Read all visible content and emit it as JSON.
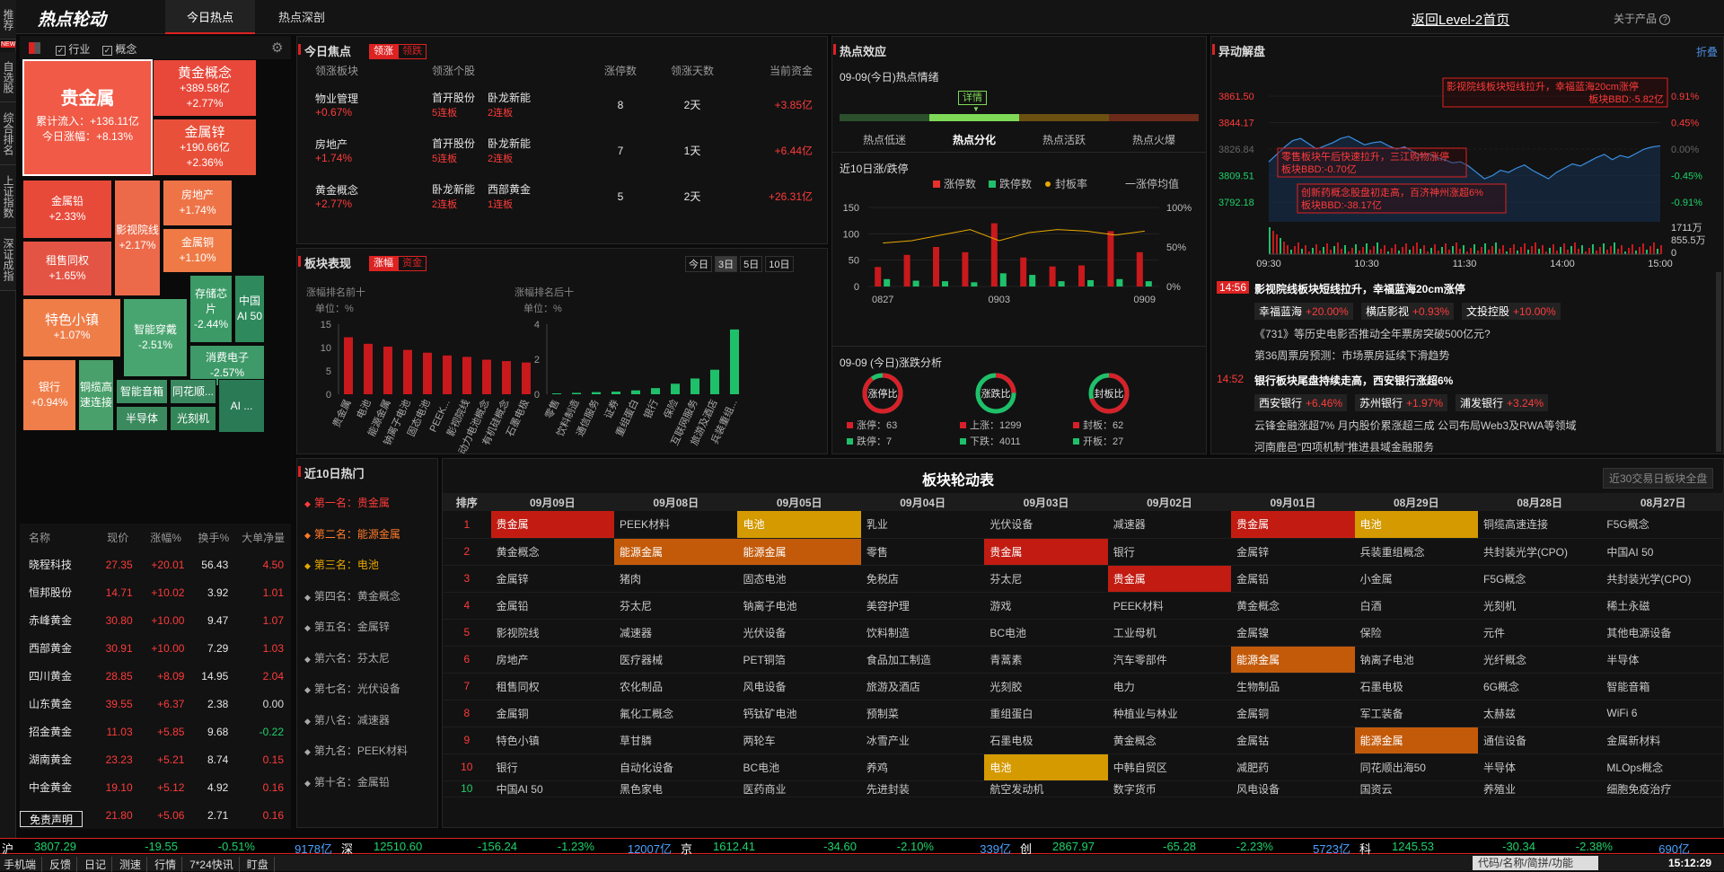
{
  "app": {
    "logo": "热点轮动",
    "tabs": [
      "今日热点",
      "热点深剖"
    ],
    "back_link": "返回Level-2首页",
    "about": "关于产品"
  },
  "sidetabs": [
    "推荐",
    "自选股",
    "综合排名",
    "上证指数",
    "深证成指"
  ],
  "sidetab_new": "NEW",
  "filter": {
    "industry": "行业",
    "concept": "概念"
  },
  "treemap": [
    {
      "name": "贵金属",
      "l1": "累计流入：+136.11亿",
      "l2": "今日涨幅：+8.13%"
    },
    {
      "name": "黄金概念",
      "l1": "+389.58亿",
      "l2": "+2.77%"
    },
    {
      "name": "金属锌",
      "l1": "+190.66亿",
      "l2": "+2.36%"
    },
    {
      "name": "金属铅",
      "l1": "+2.33%"
    },
    {
      "name": "影视院线",
      "l1": "+2.17%"
    },
    {
      "name": "房地产",
      "l1": "+1.74%"
    },
    {
      "name": "租售同权",
      "l1": "+1.65%"
    },
    {
      "name": "金属铜",
      "l1": "+1.10%"
    },
    {
      "name": "特色小镇",
      "l1": "+1.07%"
    },
    {
      "name": "智能穿戴",
      "l1": "-2.51%"
    },
    {
      "name": "存储芯片",
      "l1": "-2.44%"
    },
    {
      "name": "中国AI 50",
      "l1": ""
    },
    {
      "name": "消费电子",
      "l1": "-2.57%"
    },
    {
      "name": "银行",
      "l1": "+0.94%"
    },
    {
      "name": "铜缆高速连接",
      "l1": ""
    },
    {
      "name": "智能音箱",
      "l1": ""
    },
    {
      "name": "同花顺...",
      "l1": ""
    },
    {
      "name": "AI ...",
      "l1": ""
    },
    {
      "name": "半导体",
      "l1": ""
    },
    {
      "name": "光刻机",
      "l1": ""
    }
  ],
  "stocks": {
    "headers": [
      "名称",
      "现价",
      "涨幅%",
      "换手%",
      "大单净量"
    ],
    "rows": [
      [
        "晓程科技",
        "27.35",
        "+20.01",
        "56.43",
        "4.50"
      ],
      [
        "恒邦股份",
        "14.71",
        "+10.02",
        "3.92",
        "1.01"
      ],
      [
        "赤峰黄金",
        "30.80",
        "+10.00",
        "9.47",
        "1.07"
      ],
      [
        "西部黄金",
        "30.91",
        "+10.00",
        "7.29",
        "1.03"
      ],
      [
        "四川黄金",
        "28.85",
        "+8.09",
        "14.95",
        "2.04"
      ],
      [
        "山东黄金",
        "39.55",
        "+6.37",
        "2.38",
        "0.00"
      ],
      [
        "招金黄金",
        "11.03",
        "+5.85",
        "9.68",
        "-0.22"
      ],
      [
        "湖南黄金",
        "23.23",
        "+5.21",
        "8.74",
        "0.15"
      ],
      [
        "中金黄金",
        "19.10",
        "+5.12",
        "4.92",
        "0.16"
      ],
      [
        "",
        "21.80",
        "+5.06",
        "2.71",
        "0.16"
      ]
    ]
  },
  "disclaimer": "免责声明",
  "focus": {
    "title": "今日焦点",
    "tag_on": "领涨",
    "tag_off": "领跌",
    "headers": [
      "领涨板块",
      "领涨个股",
      "涨停数",
      "领涨天数",
      "当前资金"
    ],
    "rows": [
      {
        "sector": "物业管理",
        "pct": "+0.67%",
        "s1": "首开股份",
        "s1b": "5连板",
        "s2": "卧龙新能",
        "s2b": "2连板",
        "limit": "8",
        "days": "2天",
        "fund": "+3.85亿"
      },
      {
        "sector": "房地产",
        "pct": "+1.74%",
        "s1": "首开股份",
        "s1b": "5连板",
        "s2": "卧龙新能",
        "s2b": "2连板",
        "limit": "7",
        "days": "1天",
        "fund": "+6.44亿"
      },
      {
        "sector": "黄金概念",
        "pct": "+2.77%",
        "s1": "卧龙新能",
        "s1b": "2连板",
        "s2": "西部黄金",
        "s2b": "1连板",
        "limit": "5",
        "days": "2天",
        "fund": "+26.31亿"
      }
    ]
  },
  "perf": {
    "title": "板块表现",
    "tag_on": "涨幅",
    "tag_off": "资金",
    "periods": [
      "今日",
      "3日",
      "5日",
      "10日"
    ],
    "left_title": "涨幅排名前十",
    "right_title": "涨幅排名后十",
    "unit": "单位：%",
    "left_cats": [
      "贵金属",
      "电池",
      "能源金属",
      "钠离子电池",
      "固态电池",
      "PEEK...",
      "影视院线",
      "动力电池概念",
      "有机硅概念",
      "石墨电极"
    ],
    "left_vals": [
      12.2,
      10.8,
      10.2,
      9.5,
      8.9,
      8.3,
      8.0,
      7.4,
      7.1,
      6.8
    ],
    "left_ymax": 15,
    "left_ticks": [
      "15",
      "10",
      "5",
      "0"
    ],
    "right_cats": [
      "零售",
      "饮料制造",
      "通信服务",
      "证券",
      "重组蛋白",
      "银行",
      "保险",
      "互联网服务",
      "旅游及酒店",
      "兵装重组..."
    ],
    "right_vals": [
      0.05,
      0.08,
      0.12,
      0.15,
      0.22,
      0.35,
      0.6,
      0.9,
      1.4,
      3.7
    ],
    "right_ymax": 4,
    "right_ticks": [
      "4",
      "2",
      "0"
    ]
  },
  "effect": {
    "title": "热点效应",
    "date": "09-09(今日)热点情绪",
    "detail": "详情",
    "levels": [
      "热点低迷",
      "热点分化",
      "热点活跃",
      "热点火爆"
    ],
    "chart_title": "近10日涨/跌停",
    "legend": [
      "涨停数",
      "跌停数",
      "封板率",
      "一涨停均值"
    ],
    "x_labels": [
      "0827",
      "0903",
      "0909"
    ],
    "ticks_left": [
      "150",
      "100",
      "50",
      "0"
    ],
    "ticks_right": [
      "100%",
      "50%",
      "0%"
    ],
    "limit_up": [
      37,
      60,
      75,
      65,
      120,
      55,
      38,
      40,
      105,
      65
    ],
    "limit_down": [
      14,
      11,
      10,
      8,
      25,
      22,
      10,
      12,
      14,
      10
    ],
    "seal_rate": [
      55,
      58,
      65,
      72,
      58,
      68,
      72,
      70,
      65,
      70
    ],
    "analysis_title": "09-09 (今日)涨跌分析",
    "rings": [
      {
        "label": "涨停比",
        "a": "涨停：63",
        "b": "跌停：7"
      },
      {
        "label": "涨跌比",
        "a": "上涨：1299",
        "b": "下跌：4011"
      },
      {
        "label": "封板比",
        "a": "封板：62",
        "b": "开板：27"
      }
    ]
  },
  "abnormal": {
    "title": "异动解盘",
    "fold": "折叠",
    "y_left": [
      "3861.50",
      "3844.17",
      "3826.84",
      "3809.51",
      "3792.18"
    ],
    "y_right": [
      "0.91%",
      "0.45%",
      "0.00%",
      "-0.45%",
      "-0.91%"
    ],
    "vol": [
      "1711万",
      "855.5万",
      "0"
    ],
    "x_labels": [
      "09:30",
      "10:30",
      "11:30",
      "14:00",
      "15:00"
    ],
    "notes": [
      {
        "l1": "影视院线板块短线拉升，幸福蓝海20cm涨停",
        "l2": "板块BBD:-5.82亿"
      },
      {
        "l1": "零售板块午后快速拉升，三江购物涨停",
        "l2": "板块BBD:-0.70亿"
      },
      {
        "l1": "创新药概念股盘初走高，百济神州涨超6%",
        "l2": "板块BBD:-38.17亿"
      }
    ],
    "news": [
      {
        "time": "14:56",
        "title": "影视院线板块短线拉升，幸福蓝海20cm涨停",
        "stocks": [
          [
            "幸福蓝海",
            "+20.00%"
          ],
          [
            "横店影视",
            "+0.93%"
          ],
          [
            "文投控股",
            "+10.00%"
          ]
        ],
        "lines": [
          "《731》等历史电影否推动全年票房突破500亿元?",
          "第36周票房预测：市场票房延续下滑趋势"
        ]
      },
      {
        "time": "14:52",
        "title": "银行板块尾盘持续走高，西安银行涨超6%",
        "stocks": [
          [
            "西安银行",
            "+6.46%"
          ],
          [
            "苏州银行",
            "+1.97%"
          ],
          [
            "浦发银行",
            "+3.24%"
          ]
        ],
        "lines": [
          "云锋金融涨超7% 月内股价累涨超三成 公司布局Web3及RWA等领域",
          "河南鹿邑“四项机制”推进县域金融服务"
        ]
      }
    ]
  },
  "hot10": {
    "title": "近10日热门",
    "items": [
      "第一名：贵金属",
      "第二名：能源金属",
      "第三名：电池",
      "第四名：黄金概念",
      "第五名：金属锌",
      "第六名：芬太尼",
      "第七名：光伏设备",
      "第八名：减速器",
      "第九名：PEEK材料",
      "第十名：金属铅"
    ]
  },
  "rotation": {
    "title": "板块轮动表",
    "btn": "近30交易日板块全盘",
    "headers": [
      "排序",
      "09月09日",
      "09月08日",
      "09月05日",
      "09月04日",
      "09月03日",
      "09月02日",
      "09月01日",
      "08月29日",
      "08月28日",
      "08月27日"
    ],
    "rows": [
      [
        "1",
        "贵金属",
        "PEEK材料",
        "电池",
        "乳业",
        "光伏设备",
        "减速器",
        "贵金属",
        "电池",
        "铜缆高速连接",
        "F5G概念"
      ],
      [
        "2",
        "黄金概念",
        "能源金属",
        "能源金属",
        "零售",
        "贵金属",
        "银行",
        "金属锌",
        "兵装重组概念",
        "共封装光学(CPO)",
        "中国AI 50"
      ],
      [
        "3",
        "金属锌",
        "猪肉",
        "固态电池",
        "免税店",
        "芬太尼",
        "贵金属",
        "金属铅",
        "小金属",
        "F5G概念",
        "共封装光学(CPO)"
      ],
      [
        "4",
        "金属铅",
        "芬太尼",
        "钠离子电池",
        "美容护理",
        "游戏",
        "PEEK材料",
        "黄金概念",
        "白酒",
        "光刻机",
        "稀土永磁"
      ],
      [
        "5",
        "影视院线",
        "减速器",
        "光伏设备",
        "饮料制造",
        "BC电池",
        "工业母机",
        "金属镍",
        "保险",
        "元件",
        "其他电源设备"
      ],
      [
        "6",
        "房地产",
        "医疗器械",
        "PET铜箔",
        "食品加工制造",
        "青蒿素",
        "汽车零部件",
        "能源金属",
        "钠离子电池",
        "光纤概念",
        "半导体"
      ],
      [
        "7",
        "租售同权",
        "农化制品",
        "风电设备",
        "旅游及酒店",
        "光刻胶",
        "电力",
        "生物制品",
        "石墨电极",
        "6G概念",
        "智能音箱"
      ],
      [
        "8",
        "金属铜",
        "氟化工概念",
        "钙钛矿电池",
        "预制菜",
        "重组蛋白",
        "种植业与林业",
        "金属铜",
        "军工装备",
        "太赫兹",
        "WiFi 6"
      ],
      [
        "9",
        "特色小镇",
        "草甘膦",
        "两轮车",
        "冰雪产业",
        "石墨电极",
        "黄金概念",
        "金属钴",
        "能源金属",
        "通信设备",
        "金属新材料"
      ],
      [
        "10",
        "银行",
        "自动化设备",
        "BC电池",
        "养鸡",
        "电池",
        "中韩自贸区",
        "减肥药",
        "同花顺出海50",
        "半导体",
        "MLOps概念"
      ],
      [
        "10",
        "中国AI 50",
        "黑色家电",
        "医药商业",
        "先进封装",
        "航空发动机",
        "数字货币",
        "风电设备",
        "国资云",
        "养殖业",
        "细胞免疫治疗"
      ]
    ],
    "hl": {
      "贵金属": "hl-r",
      "能源金属": "hl-o",
      "电池": "hl-y"
    }
  },
  "index_bar": [
    {
      "n": "沪",
      "v": "3807.29",
      "c": "-19.55",
      "p": "-0.51%",
      "a": "9178亿"
    },
    {
      "n": "深",
      "v": "12510.60",
      "c": "-156.24",
      "p": "-1.23%",
      "a": "12007亿"
    },
    {
      "n": "京",
      "v": "1612.41",
      "c": "-34.60",
      "p": "-2.10%",
      "a": "339亿"
    },
    {
      "n": "创",
      "v": "2867.97",
      "c": "-65.28",
      "p": "-2.23%",
      "a": "5723亿"
    },
    {
      "n": "科",
      "v": "1245.53",
      "c": "-30.34",
      "p": "-2.38%",
      "a": "690亿"
    }
  ],
  "status": {
    "items": [
      "手机端",
      "反馈",
      "日记",
      "测速",
      "行情",
      "7*24快讯",
      "盯盘"
    ],
    "search": "代码/名称/简拼/功能",
    "time": "15:12:29"
  }
}
